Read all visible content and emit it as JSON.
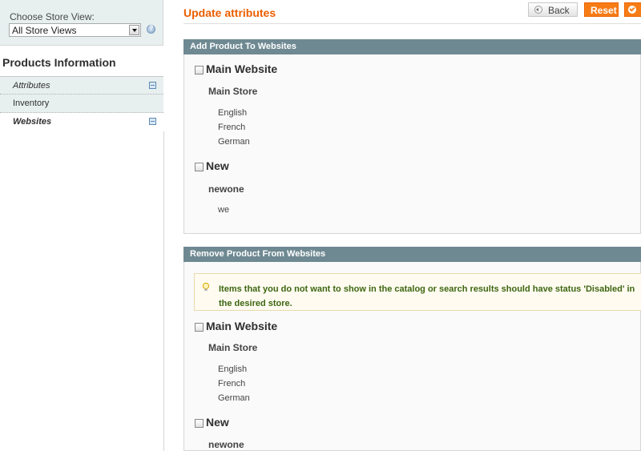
{
  "store_switcher": {
    "label": "Choose Store View:",
    "selected": "All Store Views"
  },
  "sidebar": {
    "title": "Products Information",
    "tabs": [
      {
        "label": "Attributes"
      },
      {
        "label": "Inventory"
      },
      {
        "label": "Websites"
      }
    ]
  },
  "header": {
    "title": "Update attributes",
    "back_label": "Back",
    "reset_label": "Reset"
  },
  "add_section": {
    "title": "Add Product To Websites",
    "websites": [
      {
        "name": "Main Website",
        "group": "Main Store",
        "views": [
          "English",
          "French",
          "German"
        ]
      },
      {
        "name": "New",
        "group": "newone",
        "views": [
          "we"
        ]
      }
    ]
  },
  "remove_section": {
    "title": "Remove Product From Websites",
    "notice": "Items that you do not want to show in the catalog or search results should have status 'Disabled' in the desired store.",
    "websites": [
      {
        "name": "Main Website",
        "group": "Main Store",
        "views": [
          "English",
          "French",
          "German"
        ]
      },
      {
        "name": "New",
        "group": "newone",
        "views": []
      }
    ]
  },
  "colors": {
    "accent": "#eb5e00",
    "button_orange": "#f77c16",
    "section_header": "#6f8992",
    "notice_text": "#3d6611"
  }
}
